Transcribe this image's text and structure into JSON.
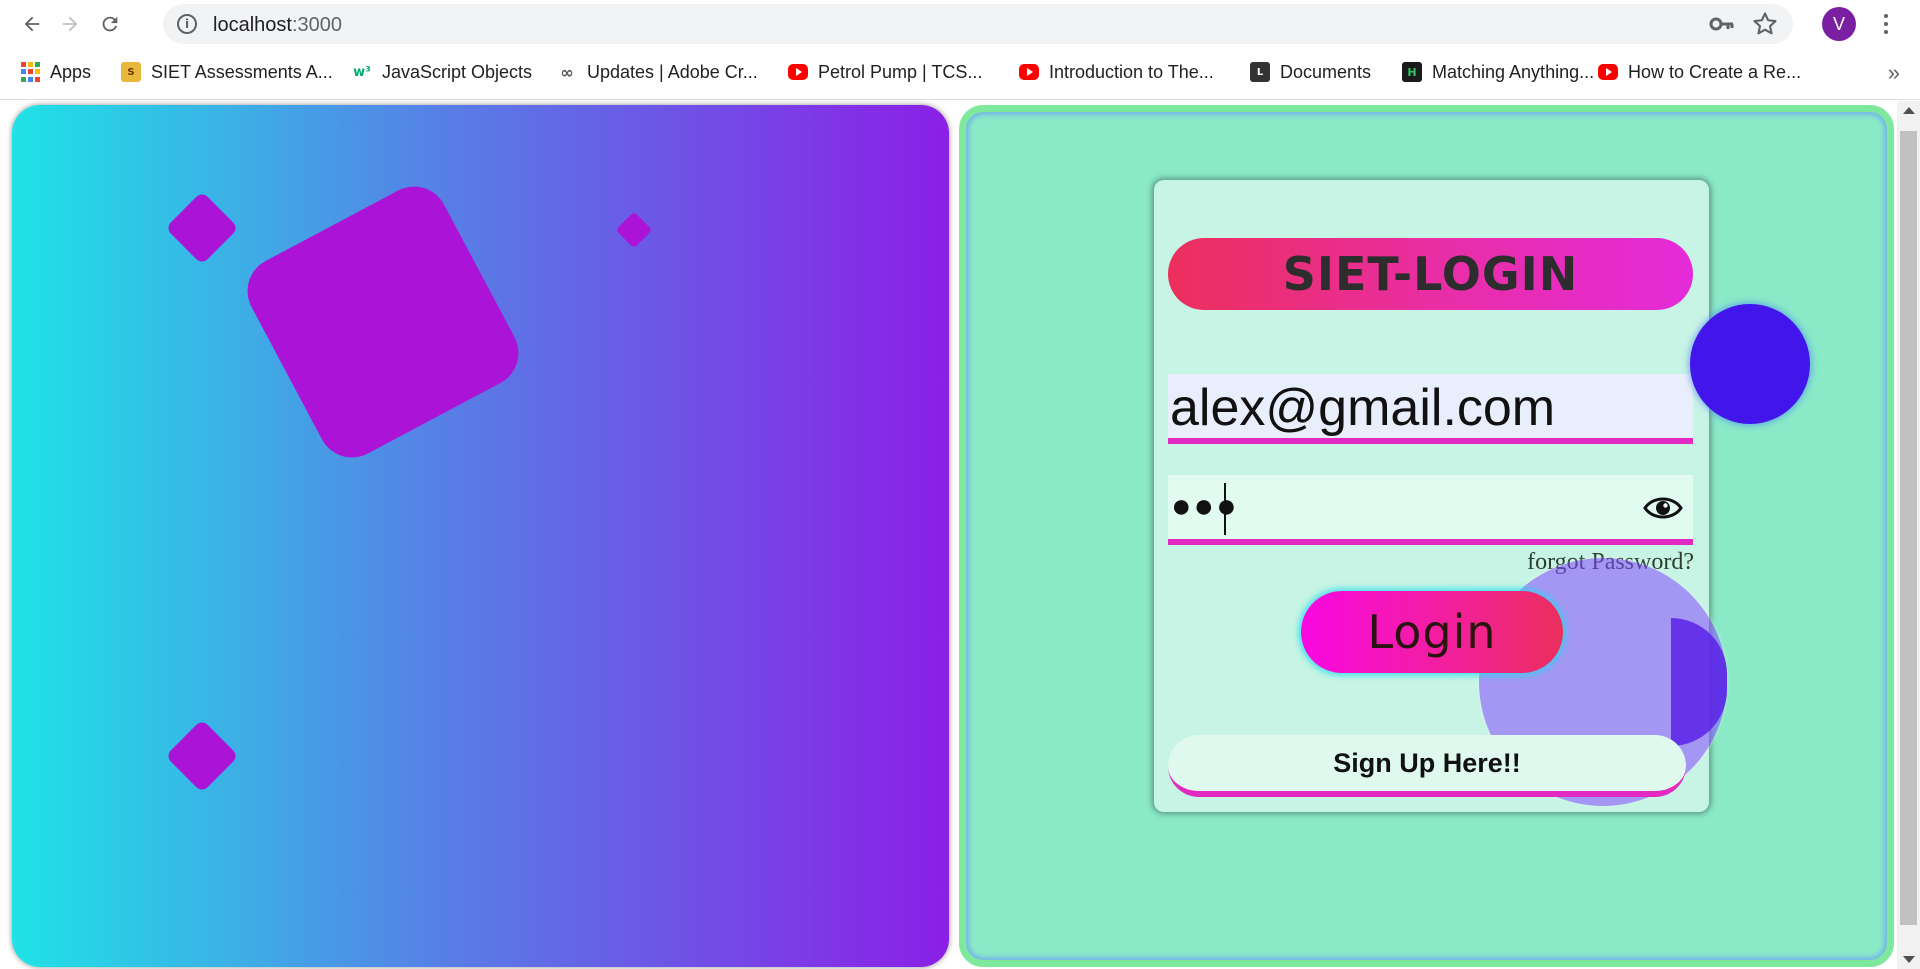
{
  "browser": {
    "url": "localhost:3000",
    "url_host": "localhost",
    "url_port": ":3000",
    "avatar_letter": "V",
    "bookmarks": [
      {
        "label": "Apps",
        "icon": "apps-grid-icon"
      },
      {
        "label": "SIET Assessments A...",
        "icon": "siet-icon"
      },
      {
        "label": "JavaScript Objects",
        "icon": "w3schools-icon"
      },
      {
        "label": "Updates | Adobe Cr...",
        "icon": "adobe-cc-icon"
      },
      {
        "label": "Petrol Pump | TCS...",
        "icon": "youtube-icon"
      },
      {
        "label": "Introduction to The...",
        "icon": "youtube-icon"
      },
      {
        "label": "Documents",
        "icon": "documents-icon"
      },
      {
        "label": "Matching Anything...",
        "icon": "hackerrank-icon"
      },
      {
        "label": "How to Create a Re...",
        "icon": "youtube-icon"
      }
    ],
    "more_bookmarks": "»"
  },
  "login": {
    "title": "SIET-LOGIN",
    "email_value": "alex@gmail.com",
    "password_dots": "●●●",
    "forgot_label": "forgot Password?",
    "login_label": "Login",
    "signup_label": "Sign Up Here!!"
  },
  "colors": {
    "left_gradient": [
      "#1fe3e6",
      "#8b1fe6"
    ],
    "shape": "#ab14d6",
    "right_bg": "#8ae9c7",
    "card_bg": "#c7f4e4",
    "accent_pink": "#e22ac2",
    "title_gradient": [
      "#ec2f5c",
      "#e42bd9"
    ],
    "login_gradient": [
      "#fa08e2",
      "#eb2e5c"
    ]
  }
}
